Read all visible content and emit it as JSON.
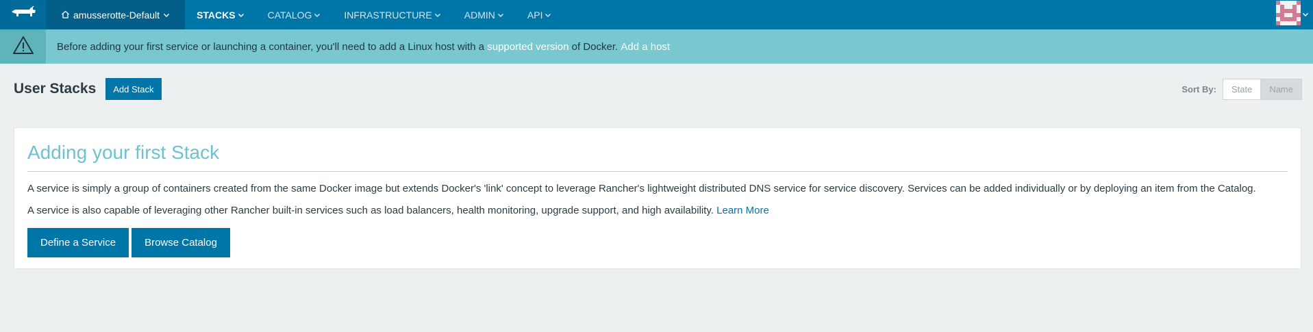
{
  "header": {
    "logo_icon": "rancher-cow-icon",
    "environment": {
      "icon": "home-icon",
      "label": "amusserotte-Default"
    },
    "nav": [
      {
        "label": "STACKS",
        "active": true
      },
      {
        "label": "CATALOG",
        "active": false
      },
      {
        "label": "INFRASTRUCTURE",
        "active": false
      },
      {
        "label": "ADMIN",
        "active": false
      },
      {
        "label": "API",
        "active": false
      }
    ],
    "avatar_icon": "user-avatar-icon"
  },
  "banner": {
    "icon": "warning-triangle-icon",
    "text_before": "Before adding your first service or launching a container, you'll need to add a Linux host with a ",
    "link_supported": "supported version",
    "text_middle": " of Docker. ",
    "link_add_host": "Add a host",
    "background": "#79c8d0"
  },
  "page": {
    "title": "User Stacks",
    "add_button": "Add Stack",
    "sort": {
      "label": "Sort By:",
      "options": [
        "State",
        "Name"
      ],
      "selected": "Name"
    }
  },
  "card": {
    "title": "Adding your first Stack",
    "paragraph1": "A service is simply a group of containers created from the same Docker image but extends Docker's 'link' concept to leverage Rancher's lightweight distributed DNS service for service discovery. Services can be added individually or by deploying an item from the Catalog.",
    "paragraph2": "A service is also capable of leveraging other Rancher built-in services such as load balancers, health monitoring, upgrade support, and high availability. ",
    "learn_more": "Learn More",
    "buttons": {
      "define_service": "Define a Service",
      "browse_catalog": "Browse Catalog"
    }
  },
  "colors": {
    "nav_bg": "#0075a8",
    "accent": "#0075a8",
    "title_teal": "#6cc3cf",
    "page_bg": "#edf0f0"
  }
}
